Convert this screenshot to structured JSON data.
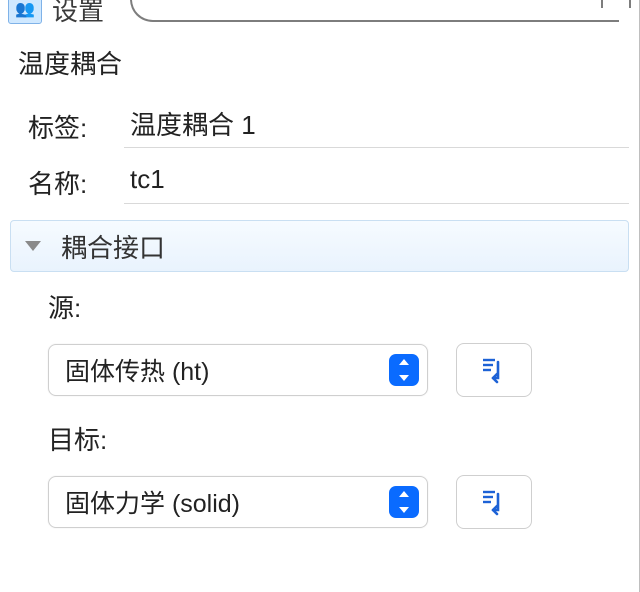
{
  "header": {
    "icon_name": "coupling-icon",
    "title": "设置"
  },
  "subtitle": "温度耦合",
  "form": {
    "label_caption": "标签:",
    "label_value": "温度耦合 1",
    "name_caption": "名称:",
    "name_value": "tc1"
  },
  "section": {
    "title": "耦合接口"
  },
  "source": {
    "caption": "源:",
    "selected": "固体传热 (ht)"
  },
  "target": {
    "caption": "目标:",
    "selected": "固体力学 (solid)"
  }
}
